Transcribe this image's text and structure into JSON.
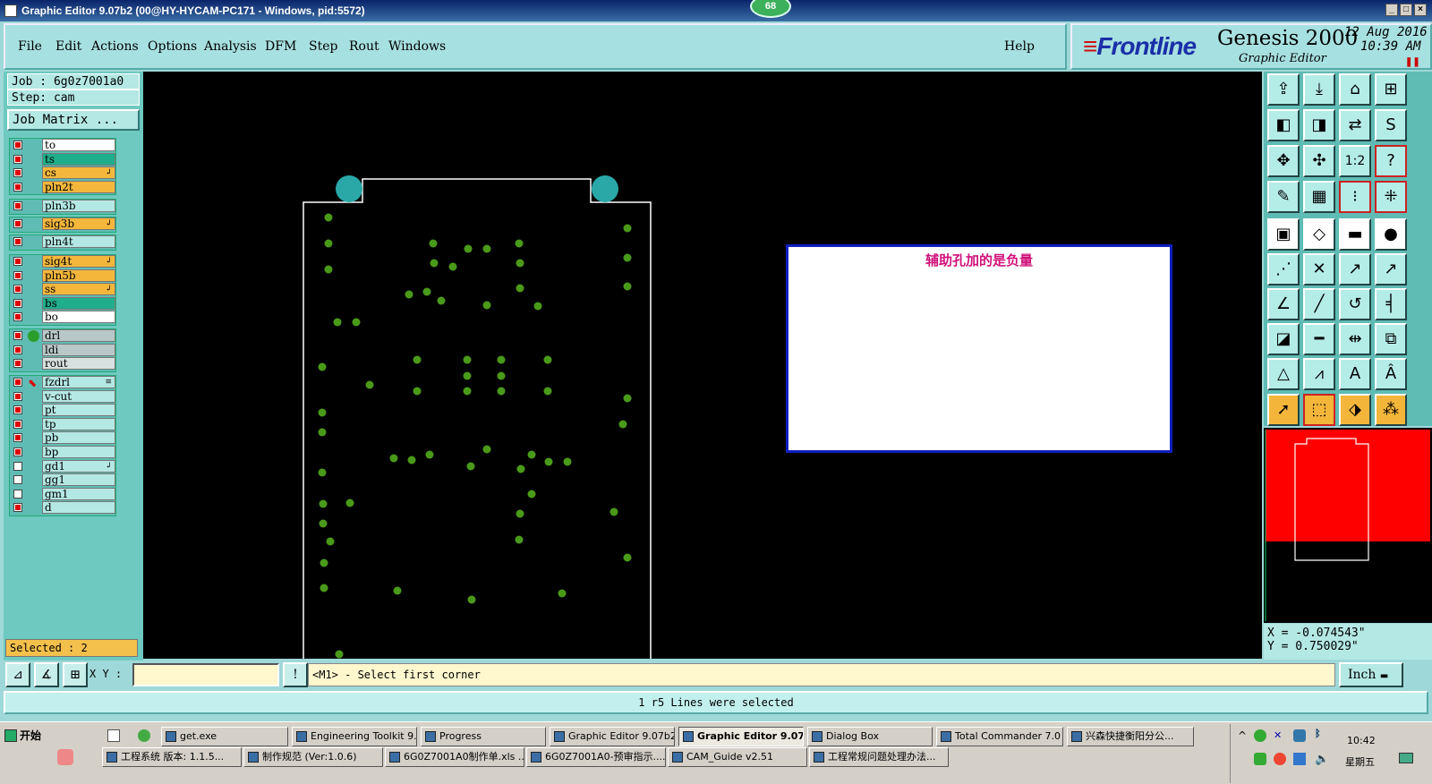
{
  "window": {
    "title": "Graphic Editor 9.07b2 (00@HY-HYCAM-PC171 - Windows, pid:5572)",
    "badge": "68"
  },
  "menu": [
    {
      "label": "File"
    },
    {
      "label": "Edit"
    },
    {
      "label": "Actions"
    },
    {
      "label": "Options"
    },
    {
      "label": "Analysis"
    },
    {
      "label": "DFM"
    },
    {
      "label": "Step"
    },
    {
      "label": "Rout"
    },
    {
      "label": "Windows"
    }
  ],
  "help_label": "Help",
  "brand": {
    "logo": "Frontline",
    "product": "Genesis 2000",
    "subtitle": "Graphic Editor",
    "date_line1": "12 Aug 2016",
    "date_line2": "10:39 AM"
  },
  "job": {
    "job_line": "Job : 6g0z7001a0",
    "step_line": "Step: cam",
    "matrix_button": "Job Matrix ..."
  },
  "layers": [
    {
      "group": 0,
      "name": "to",
      "color": "#ffffff",
      "mark": ""
    },
    {
      "group": 0,
      "name": "ts",
      "color": "#1fae8c",
      "mark": ""
    },
    {
      "group": 0,
      "name": "cs",
      "color": "#f4b73c",
      "mark": "↲"
    },
    {
      "group": 0,
      "name": "pln2t",
      "color": "#f4b73c",
      "mark": ""
    },
    {
      "group": 1,
      "name": "pln3b",
      "color": "#b4e8e4",
      "mark": ""
    },
    {
      "group": 2,
      "name": "sig3b",
      "color": "#f4b73c",
      "mark": "↲"
    },
    {
      "group": 3,
      "name": "pln4t",
      "color": "#b4e8e4",
      "mark": ""
    },
    {
      "group": 4,
      "name": "sig4t",
      "color": "#f4b73c",
      "mark": "↲"
    },
    {
      "group": 4,
      "name": "pln5b",
      "color": "#f4b73c",
      "mark": ""
    },
    {
      "group": 4,
      "name": "ss",
      "color": "#f4b73c",
      "mark": "↲"
    },
    {
      "group": 4,
      "name": "bs",
      "color": "#1fae8c",
      "mark": ""
    },
    {
      "group": 4,
      "name": "bo",
      "color": "#ffffff",
      "mark": ""
    },
    {
      "group": 5,
      "name": "drl",
      "color": "#b8c8c8",
      "mark": ""
    },
    {
      "group": 5,
      "name": "ldi",
      "color": "#b8c8c8",
      "mark": ""
    },
    {
      "group": 5,
      "name": "rout",
      "color": "#d8e0e0",
      "mark": ""
    },
    {
      "group": 6,
      "name": "fzdrl",
      "color": "#b4e8e4",
      "mark": "≡"
    },
    {
      "group": 6,
      "name": "v-cut",
      "color": "#b4e8e4",
      "mark": ""
    },
    {
      "group": 6,
      "name": "pt",
      "color": "#b4e8e4",
      "mark": ""
    },
    {
      "group": 6,
      "name": "tp",
      "color": "#b4e8e4",
      "mark": ""
    },
    {
      "group": 6,
      "name": "pb",
      "color": "#b4e8e4",
      "mark": ""
    },
    {
      "group": 6,
      "name": "bp",
      "color": "#b4e8e4",
      "mark": ""
    },
    {
      "group": 6,
      "name": "gd1",
      "color": "#b4e8e4",
      "mark": "↲"
    },
    {
      "group": 6,
      "name": "gg1",
      "color": "#b4e8e4",
      "mark": ""
    },
    {
      "group": 6,
      "name": "gm1",
      "color": "#b4e8e4",
      "mark": ""
    },
    {
      "group": 6,
      "name": "d",
      "color": "#b4e8e4",
      "mark": ""
    }
  ],
  "selected_label": "Selected : 2",
  "note_text": "辅助孔加的是负量",
  "coords": {
    "x": "X = -0.074543\"",
    "y": "Y = 0.750029\""
  },
  "command": {
    "xy_label": "X Y :",
    "xy_value": "",
    "prompt": "<M1> - Select first corner",
    "unit": "Inch"
  },
  "status_message": "1 r5 Lines were selected",
  "taskbar": {
    "start": "开始",
    "row1": [
      "get.exe",
      "Engineering Toolkit 9....",
      "Progress",
      "Graphic Editor 9.07b2...",
      "Graphic Editor 9.07...",
      "Dialog Box",
      "Total Commander 7.0 ...",
      "兴森快捷衡阳分公..."
    ],
    "row2": [
      "工程系统  版本: 1.1.5...",
      "制作规范 (Ver:1.0.6)",
      "6G0Z7001A0制作单.xls ...",
      "6G0Z7001A0-预审指示....",
      "CAM_Guide v2.51",
      "工程常规问题处理办法..."
    ],
    "clock": "10:42",
    "weekday": "星期五"
  },
  "colors": {
    "canvas": "#000000",
    "pad": "#4a9a1a",
    "outline": "#ffffff",
    "fiducial": "#2aa7a7",
    "panel": "#9fd8d8"
  }
}
